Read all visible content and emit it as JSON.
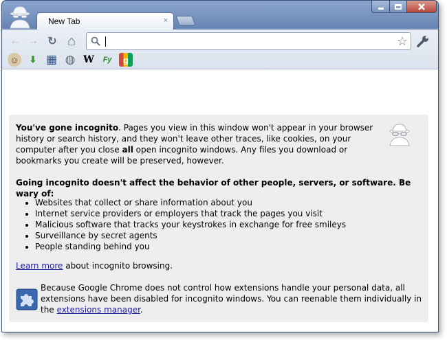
{
  "window": {
    "accent": "#6f8cb8"
  },
  "tab": {
    "title": "New Tab",
    "close_glyph": "×"
  },
  "toolbar": {
    "back_glyph": "←",
    "forward_glyph": "→",
    "reload_glyph": "↻",
    "home_glyph": "⌂",
    "star_glyph": "☆"
  },
  "omnibox": {
    "value": "",
    "placeholder": ""
  },
  "bookmarks": [
    {
      "icon": "avatar-face-icon",
      "glyph": "☺"
    },
    {
      "icon": "download-icon",
      "glyph": "⬇"
    },
    {
      "icon": "grid-calculator-icon",
      "glyph": "▦"
    },
    {
      "icon": "globe-icon",
      "glyph": "◍"
    },
    {
      "icon": "wikipedia-icon",
      "glyph": "W"
    },
    {
      "icon": "feedly-icon",
      "glyph": "Fy"
    },
    {
      "icon": "google-icon",
      "glyph": "g"
    }
  ],
  "incognito": {
    "intro_bold": "You've gone incognito",
    "intro_rest_1": ". Pages you view in this window won't appear in your browser history or search history, and they won't leave other traces, like cookies, on your computer after you close ",
    "intro_all": "all",
    "intro_rest_2": " open incognito windows. Any files you download or bookmarks you create will be preserved, however.",
    "heading": "Going incognito doesn't affect the behavior of other people, servers, or software. Be wary of:",
    "list": [
      "Websites that collect or share information about you",
      "Internet service providers or employers that track the pages you visit",
      "Malicious software that tracks your keystrokes in exchange for free smileys",
      "Surveillance by secret agents",
      "People standing behind you"
    ],
    "learn_more_link": "Learn more",
    "learn_more_rest": " about incognito browsing.",
    "extensions_text": "Because Google Chrome does not control how extensions handle your personal data, all extensions have been disabled for incognito windows. You can reenable them individually in the ",
    "extensions_link": "extensions manager",
    "extensions_end": "."
  }
}
